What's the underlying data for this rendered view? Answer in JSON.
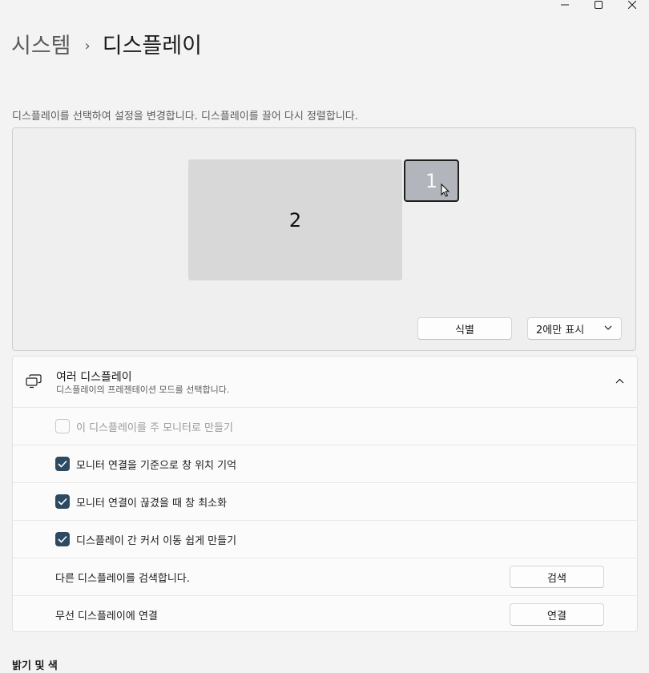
{
  "window": {
    "controls": [
      "minimize-icon",
      "maximize-icon",
      "close-icon"
    ]
  },
  "breadcrumb": {
    "parent": "시스템",
    "separator": "›",
    "current": "디스플레이"
  },
  "arrange": {
    "hint": "디스플레이를 선택하여 설정을 변경합니다. 디스플레이를 끌어 다시 정렬합니다.",
    "monitors": [
      {
        "number": "2",
        "selected": false
      },
      {
        "number": "1",
        "selected": true
      }
    ],
    "identify_button": "식별",
    "display_mode_select": "2에만 표시"
  },
  "multiple_displays": {
    "icon": "multiple-displays-icon",
    "title": "여러 디스플레이",
    "subtitle": "디스플레이의 프레젠테이션 모드를 선택합니다.",
    "expanded": true,
    "options": [
      {
        "label": "이 디스플레이를 주 모니터로 만들기",
        "checked": false,
        "disabled": true
      },
      {
        "label": "모니터 연결을 기준으로 창 위치 기억",
        "checked": true,
        "disabled": false
      },
      {
        "label": "모니터 연결이 끊겼을 때 창 최소화",
        "checked": true,
        "disabled": false
      },
      {
        "label": "디스플레이 간 커서 이동 쉽게 만들기",
        "checked": true,
        "disabled": false
      }
    ],
    "detect": {
      "label": "다른 디스플레이를 검색합니다.",
      "button": "검색"
    },
    "wireless": {
      "label": "무선 디스플레이에 연결",
      "button": "연결"
    }
  },
  "next_section": {
    "title": "밝기 및 색"
  },
  "colors": {
    "accent": "#2d4a63",
    "background": "#f3f3f3"
  }
}
